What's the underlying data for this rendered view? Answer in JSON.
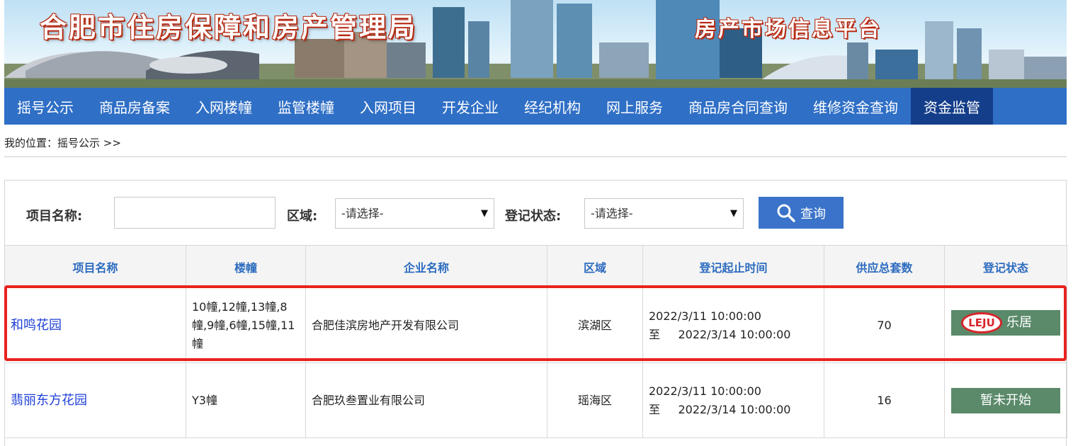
{
  "banner": {
    "title": "合肥市住房保障和房产管理局",
    "subtitle": "房产市场信息平台"
  },
  "nav": {
    "items": [
      {
        "label": "摇号公示"
      },
      {
        "label": "商品房备案"
      },
      {
        "label": "入网楼幢"
      },
      {
        "label": "监管楼幢"
      },
      {
        "label": "入网项目"
      },
      {
        "label": "开发企业"
      },
      {
        "label": "经纪机构"
      },
      {
        "label": "网上服务"
      },
      {
        "label": "商品房合同查询"
      },
      {
        "label": "维修资金查询"
      },
      {
        "label": "资金监管"
      }
    ],
    "active_index": 10,
    "color": "#2f6fc6",
    "active_color": "#143e8a"
  },
  "breadcrumb": {
    "text": "我的位置：摇号公示 >>"
  },
  "search": {
    "project_label": "项目名称:",
    "project_value": "",
    "district_label": "区域:",
    "district_value": "-请选择-",
    "status_label": "登记状态:",
    "status_value": "-请选择-",
    "query_label": "查询"
  },
  "table": {
    "headers": [
      "项目名称",
      "楼幢",
      "企业名称",
      "区域",
      "登记起止时间",
      "供应总套数",
      "登记状态"
    ],
    "rows": [
      {
        "project": "和鸣花园",
        "buildings": "10幢,12幢,13幢,8幢,9幢,6幢,15幢,11幢",
        "company": "合肥佳滨房地产开发有限公司",
        "district": "滨湖区",
        "start": "2022/3/11 10:00:00",
        "end_prefix": "至",
        "end": "2022/3/14 10:00:00",
        "total": "70",
        "status": "",
        "watermark_logo": "LEJU",
        "watermark_text": "乐居"
      },
      {
        "project": "翡丽东方花园",
        "buildings": "Y3幢",
        "company": "合肥玖叁置业有限公司",
        "district": "瑶海区",
        "start": "2022/3/11 10:00:00",
        "end_prefix": "至",
        "end": "2022/3/14 10:00:00",
        "total": "16",
        "status": "暂未开始"
      }
    ]
  },
  "colors": {
    "header_text": "#2c6bbf",
    "link": "#1f3fd6",
    "status_button": "#5a8a6a",
    "highlight": "#e8231f"
  }
}
